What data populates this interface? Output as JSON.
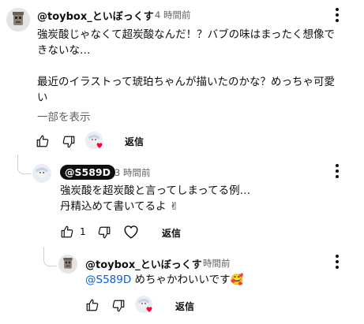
{
  "comment": {
    "author": "@toybox_といぼっくす",
    "time": "4 時間前",
    "line1": "強炭酸じゃなくて超炭酸なんだ！？バブの味はまったく想像で",
    "line2": "きないな…",
    "line3": "最近のイラストって琥珀ちゃんが描いたのかな？めっちゃ可愛",
    "line4": "い",
    "read_more": "一部を表示",
    "reply_label": "返信"
  },
  "reply1": {
    "author": "@S589D",
    "time": "3 時間前",
    "line1": "強炭酸を超炭酸と言ってしまってる例…",
    "line2": "丹精込めて書いてるよ ✌",
    "like_count": "1",
    "reply_label": "返信"
  },
  "reply2": {
    "author": "@toybox_といぼっくす",
    "time": "3 時間前",
    "mention": "@S589D",
    "text": " めちゃかわいいです🥰",
    "reply_label": "返信"
  },
  "icons": {
    "like": "thumbs-up-icon",
    "dislike": "thumbs-down-icon",
    "heart": "heart-icon",
    "more": "more-vert-icon"
  },
  "colors": {
    "mention": "#065fd4",
    "heart_badge": "#ff0033",
    "chip_bg": "#0f0f0f"
  }
}
